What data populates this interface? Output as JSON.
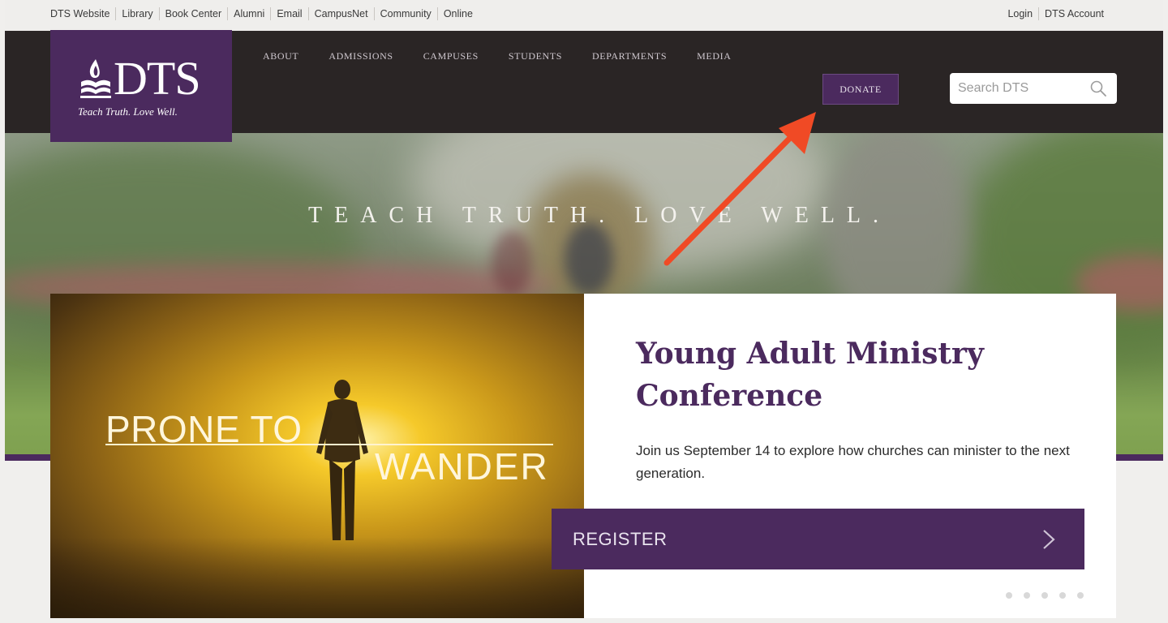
{
  "utility_nav": {
    "left_links": [
      "DTS Website",
      "Library",
      "Book Center",
      "Alumni",
      "Email",
      "CampusNet",
      "Community",
      "Online"
    ],
    "right_links": [
      "Login",
      "DTS Account"
    ]
  },
  "logo": {
    "wordmark": "DTS",
    "tagline": "Teach Truth. Love Well."
  },
  "main_nav": {
    "items": [
      "ABOUT",
      "ADMISSIONS",
      "CAMPUSES",
      "STUDENTS",
      "DEPARTMENTS",
      "MEDIA"
    ],
    "donate": "DONATE"
  },
  "search": {
    "placeholder": "Search DTS"
  },
  "hero": {
    "tagline": "TEACH TRUTH. LOVE WELL."
  },
  "feature": {
    "image_line1": "PRONE TO",
    "image_line2": "WANDER",
    "title": "Young Adult Ministry Conference",
    "description": "Join us September 14 to explore how churches can minister to the next generation.",
    "button_label": "REGISTER",
    "slide_count": 5
  },
  "colors": {
    "brand_purple": "#4b2a5e",
    "nav_background": "#2a2525",
    "annotation_red": "#f04a25"
  }
}
